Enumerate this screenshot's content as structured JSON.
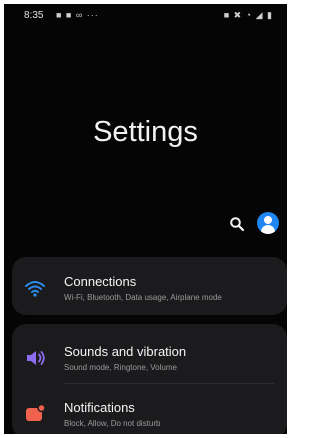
{
  "status_bar": {
    "time": "8:35",
    "left_icons": "■ ■ ∞ ···",
    "right_icons": "■ ✖ ◔ ◢ ▮"
  },
  "header": {
    "title": "Settings"
  },
  "toolbar": {
    "search_icon": "search-icon",
    "profile_icon": "account-icon"
  },
  "settings": {
    "items": [
      {
        "title": "Connections",
        "subtitle": "Wi-Fi, Bluetooth, Data usage, Airplane mode",
        "icon": "wifi-icon",
        "icon_color": "#2d8cf0"
      },
      {
        "title": "Sounds and vibration",
        "subtitle": "Sound mode, Ringtone, Volume",
        "icon": "volume-icon",
        "icon_color": "#8c6cf0"
      },
      {
        "title": "Notifications",
        "subtitle": "Block, Allow, Do not disturb",
        "icon": "notifications-icon",
        "icon_color": "#f0614e"
      }
    ]
  },
  "colors": {
    "background": "#050505",
    "card": "#1b1b1d",
    "accent": "#1e88f0"
  }
}
